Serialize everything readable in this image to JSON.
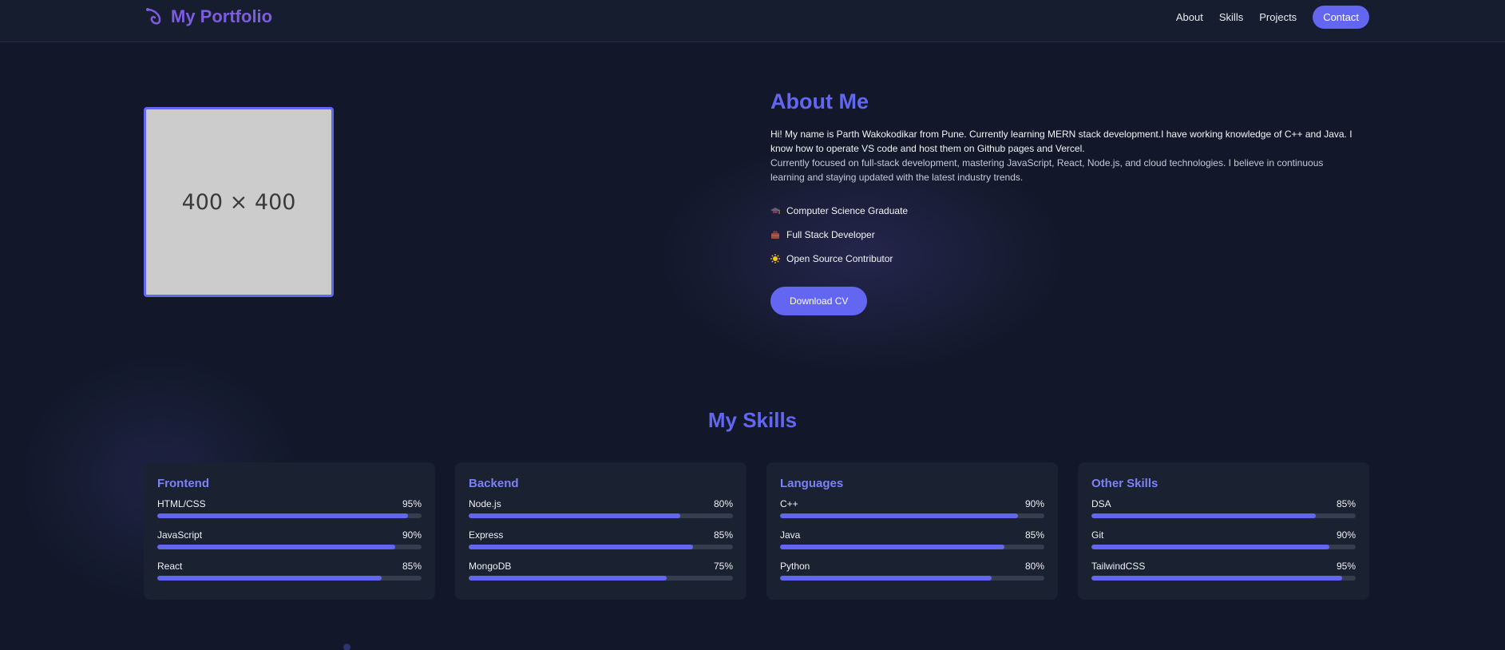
{
  "header": {
    "logo_text": "My Portfolio",
    "nav": [
      {
        "label": "About"
      },
      {
        "label": "Skills"
      },
      {
        "label": "Projects"
      }
    ],
    "contact_label": "Contact"
  },
  "photo": {
    "placeholder_text": "400 × 400"
  },
  "about": {
    "title": "About Me",
    "para1": "Hi! My name is Parth Wakokodikar from Pune. Currently learning MERN stack development.I have working knowledge of C++ and Java. I know how to operate VS code and host them on Github pages and Vercel.",
    "para2": "Currently focused on full-stack development, mastering JavaScript, React, Node.js, and cloud technologies. I believe in continuous learning and staying updated with the latest industry trends.",
    "points": [
      {
        "icon": "graduation-icon",
        "label": "Computer Science Graduate"
      },
      {
        "icon": "briefcase-icon",
        "label": "Full Stack Developer"
      },
      {
        "icon": "sun-icon",
        "label": "Open Source Contributor"
      }
    ],
    "cv_button": "Download CV"
  },
  "skills": {
    "title": "My Skills",
    "categories": [
      {
        "name": "Frontend",
        "items": [
          {
            "label": "HTML/CSS",
            "percent": "95%",
            "value": 95
          },
          {
            "label": "JavaScript",
            "percent": "90%",
            "value": 90
          },
          {
            "label": "React",
            "percent": "85%",
            "value": 85
          }
        ]
      },
      {
        "name": "Backend",
        "items": [
          {
            "label": "Node.js",
            "percent": "80%",
            "value": 80
          },
          {
            "label": "Express",
            "percent": "85%",
            "value": 85
          },
          {
            "label": "MongoDB",
            "percent": "75%",
            "value": 75
          }
        ]
      },
      {
        "name": "Languages",
        "items": [
          {
            "label": "C++",
            "percent": "90%",
            "value": 90
          },
          {
            "label": "Java",
            "percent": "85%",
            "value": 85
          },
          {
            "label": "Python",
            "percent": "80%",
            "value": 80
          }
        ]
      },
      {
        "name": "Other Skills",
        "items": [
          {
            "label": "DSA",
            "percent": "85%",
            "value": 85
          },
          {
            "label": "Git",
            "percent": "90%",
            "value": 90
          },
          {
            "label": "TailwindCSS",
            "percent": "95%",
            "value": 95
          }
        ]
      }
    ]
  },
  "colors": {
    "accent": "#6366f1",
    "logo": "#7c5ce0",
    "background": "#121829",
    "card": "#1a2131"
  }
}
